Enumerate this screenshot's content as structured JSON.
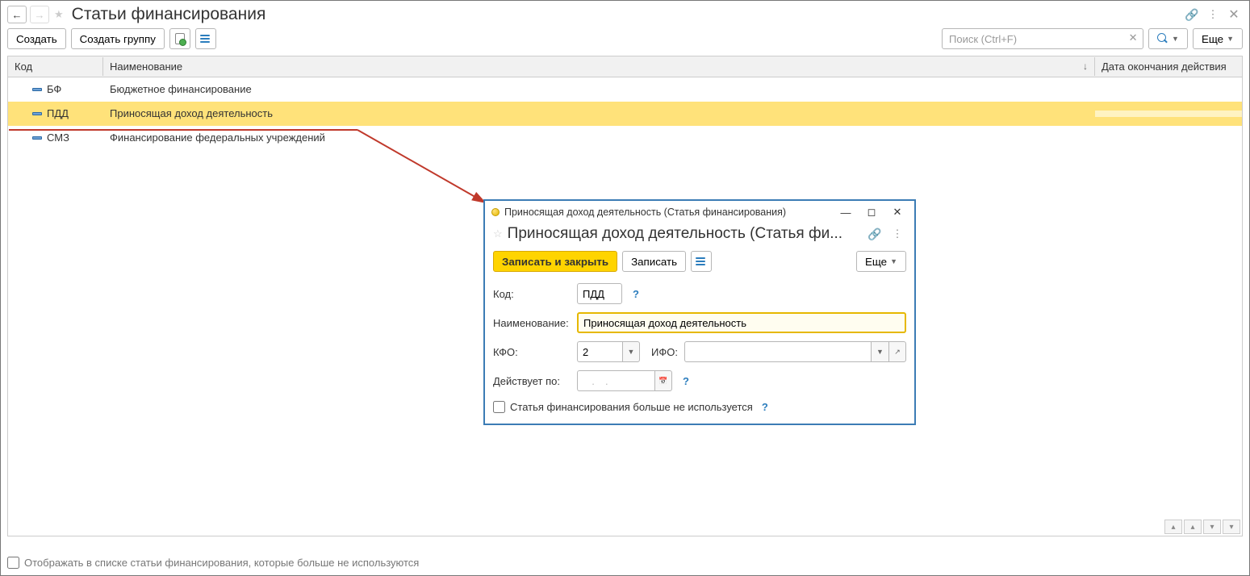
{
  "page": {
    "title": "Статьи финансирования"
  },
  "toolbar": {
    "create": "Создать",
    "create_group": "Создать группу",
    "search_placeholder": "Поиск (Ctrl+F)",
    "more": "Еще"
  },
  "table": {
    "headers": {
      "code": "Код",
      "name": "Наименование",
      "end_date": "Дата окончания действия"
    },
    "rows": [
      {
        "code": "БФ",
        "name": "Бюджетное финансирование"
      },
      {
        "code": "ПДД",
        "name": "Приносящая доход деятельность"
      },
      {
        "code": "СМЗ",
        "name": "Финансирование федеральных учреждений"
      }
    ]
  },
  "footer": {
    "show_unused": "Отображать в списке статьи финансирования, которые больше не используются"
  },
  "dialog": {
    "window_title": "Приносящая доход деятельность (Статья финансирования)",
    "title": "Приносящая доход деятельность (Статья фи...",
    "toolbar": {
      "write_close": "Записать и закрыть",
      "write": "Записать",
      "more": "Еще"
    },
    "fields": {
      "code_label": "Код:",
      "code_value": "ПДД",
      "name_label": "Наименование:",
      "name_value": "Приносящая доход деятельность",
      "kfo_label": "КФО:",
      "kfo_value": "2",
      "ifo_label": "ИФО:",
      "ifo_value": "",
      "valid_label": "Действует по:",
      "valid_value": "  .  .    ",
      "unused_label": "Статья финансирования больше не используется"
    }
  }
}
